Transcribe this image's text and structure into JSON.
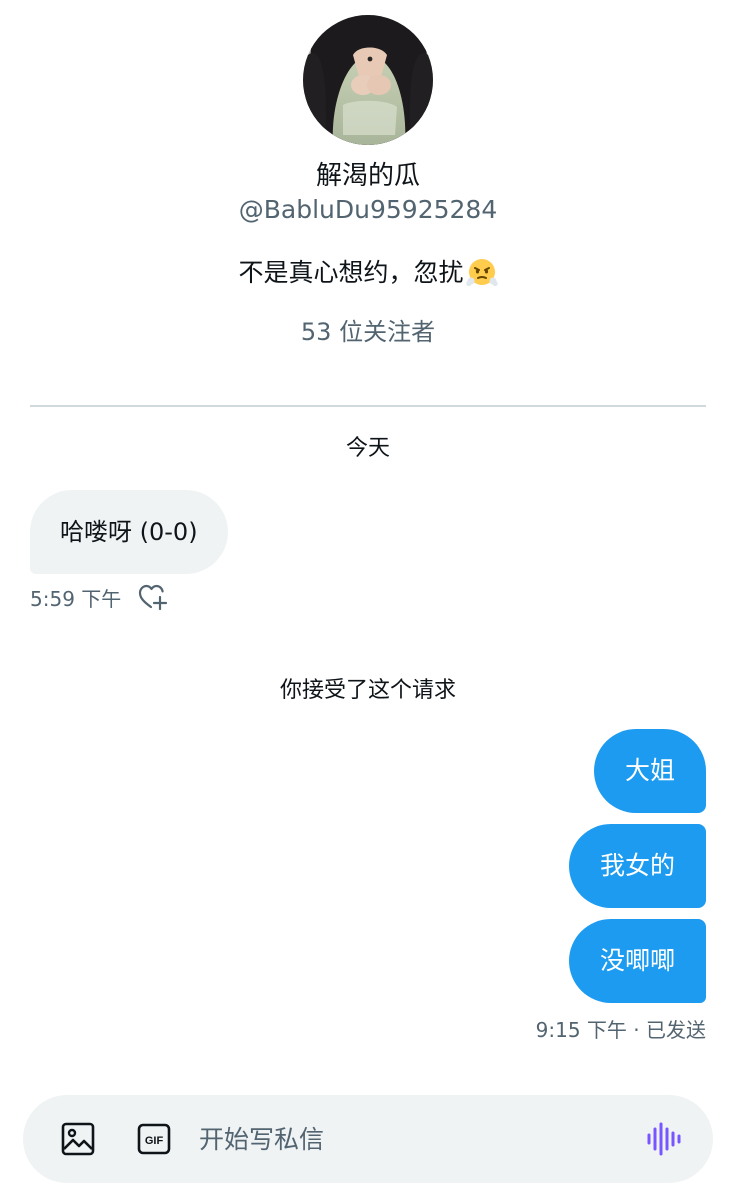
{
  "profile": {
    "name": "解渴的瓜",
    "handle": "@BabluDu95925284",
    "bio": "不是真心想约，忽扰",
    "bio_emoji": "face-with-steam-emoji",
    "followers": "53 位关注者"
  },
  "conversation": {
    "day_label": "今天",
    "incoming": {
      "text": "哈喽呀 (0-0)",
      "time": "5:59 下午"
    },
    "system_note": "你接受了这个请求",
    "outgoing": [
      {
        "text": "大姐"
      },
      {
        "text": "我女的"
      },
      {
        "text": "没唧唧"
      }
    ],
    "outgoing_status": "9:15 下午 · 已发送"
  },
  "composer": {
    "placeholder": "开始写私信",
    "gif_label": "GIF"
  },
  "colors": {
    "accent": "#1d9bf0",
    "voice": "#7856ff",
    "muted_text": "#536471",
    "bubble_in": "#eff3f4"
  }
}
